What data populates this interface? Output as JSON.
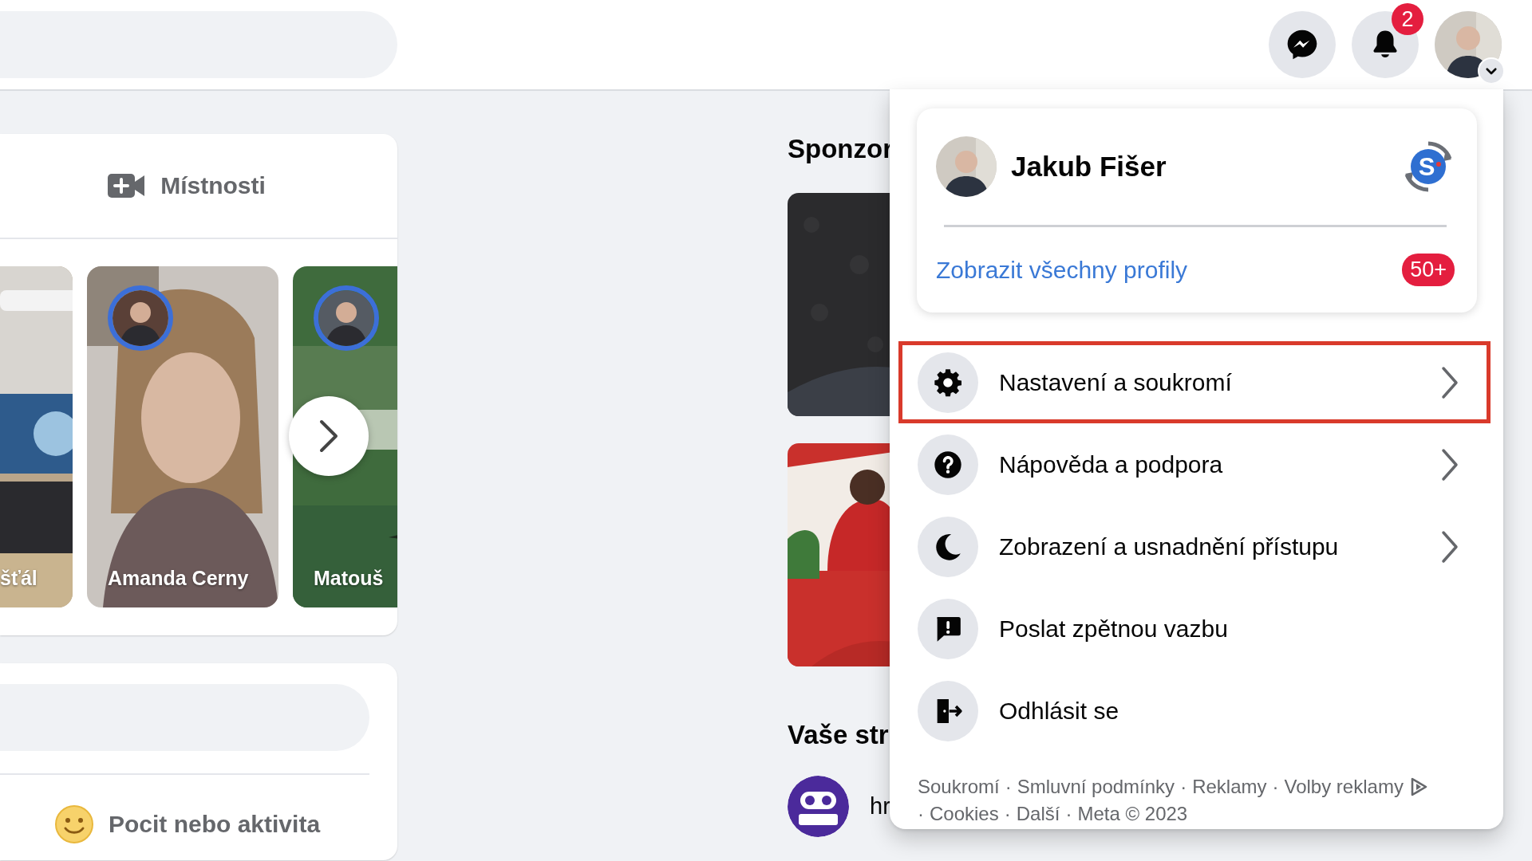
{
  "top_bar": {
    "notifications_badge": "2"
  },
  "rooms": {
    "label": "Místnosti"
  },
  "stories": [
    {
      "name": "šťál",
      "kind": "boxes"
    },
    {
      "name": "Amanda Cerny",
      "kind": "portrait"
    },
    {
      "name": "Matouš",
      "kind": "green"
    }
  ],
  "composer": {
    "feeling_label": "Pocit nebo aktivita"
  },
  "sidebar": {
    "sponsored_heading": "Sponzor",
    "pages_heading": "Vaše str",
    "page_name": "hr"
  },
  "account_menu": {
    "profile_name": "Jakub Fišer",
    "logo_letter": "S",
    "see_all_profiles": "Zobrazit všechny profily",
    "profiles_badge": "50+",
    "items": [
      {
        "label": "Nastavení a soukromí",
        "kind": "gear",
        "has_submenu": true,
        "highlighted": true
      },
      {
        "label": "Nápověda a podpora",
        "kind": "help",
        "has_submenu": true,
        "highlighted": false
      },
      {
        "label": "Zobrazení a usnadnění přístupu",
        "kind": "moon",
        "has_submenu": true,
        "highlighted": false
      },
      {
        "label": "Poslat zpětnou vazbu",
        "kind": "feedback",
        "has_submenu": false,
        "highlighted": false
      },
      {
        "label": "Odhlásit se",
        "kind": "logout",
        "has_submenu": false,
        "highlighted": false
      }
    ],
    "footer": {
      "separator": "·",
      "links": [
        {
          "label": "Soukromí"
        },
        {
          "label": "Smluvní podmínky"
        },
        {
          "label": "Reklamy"
        },
        {
          "label": "Volby reklamy",
          "kind": "adchoices"
        },
        {
          "label": "Cookies"
        },
        {
          "label": "Další"
        }
      ],
      "copyright": "Meta © 2023"
    }
  }
}
